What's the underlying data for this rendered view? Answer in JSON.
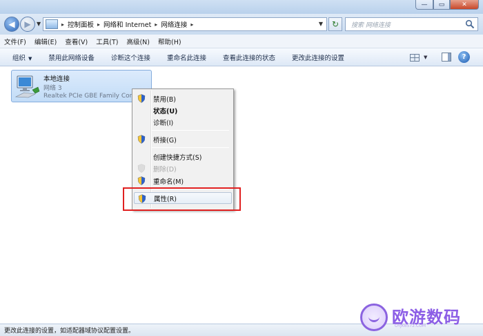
{
  "window": {
    "minimize_glyph": "—",
    "maximize_glyph": "▭",
    "close_glyph": "✕"
  },
  "address": {
    "crumbs": [
      "控制面板",
      "网络和 Internet",
      "网络连接"
    ],
    "search_placeholder": "搜索 网络连接"
  },
  "menubar": {
    "items": [
      "文件(F)",
      "编辑(E)",
      "查看(V)",
      "工具(T)",
      "高级(N)",
      "帮助(H)"
    ]
  },
  "commandbar": {
    "items": [
      "组织",
      "禁用此网络设备",
      "诊断这个连接",
      "重命名此连接",
      "查看此连接的状态",
      "更改此连接的设置"
    ],
    "organize_caret": "▼"
  },
  "connection": {
    "name": "本地连接",
    "network": "网络  3",
    "device": "Realtek PCIe GBE Family Controller"
  },
  "context_menu": {
    "items": [
      {
        "label": "禁用(B)",
        "shield": true,
        "bold": false,
        "disabled": false
      },
      {
        "label": "状态(U)",
        "shield": false,
        "bold": true,
        "disabled": false
      },
      {
        "label": "诊断(I)",
        "shield": false,
        "bold": false,
        "disabled": false
      },
      {
        "label": "桥接(G)",
        "shield": true,
        "bold": false,
        "disabled": false
      },
      {
        "label": "创建快捷方式(S)",
        "shield": false,
        "bold": false,
        "disabled": false
      },
      {
        "label": "删除(D)",
        "shield": true,
        "bold": false,
        "disabled": true
      },
      {
        "label": "重命名(M)",
        "shield": true,
        "bold": false,
        "disabled": false
      },
      {
        "label": "属性(R)",
        "shield": true,
        "bold": false,
        "disabled": false,
        "highlighted": true
      }
    ]
  },
  "statusbar": {
    "text": "更改此连接的设置，如适配器域协议配置设置。"
  },
  "watermark": {
    "brand": "欧游数码",
    "sub": "OYJK6572.COM"
  },
  "colors": {
    "highlight_box": "#e02020",
    "brand_purple": "#8c5ee6"
  }
}
